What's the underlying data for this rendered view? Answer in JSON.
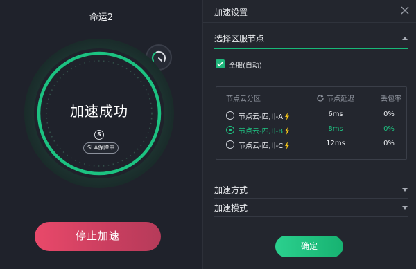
{
  "left": {
    "game_title": "命运2",
    "status": "加速成功",
    "shield_letter": "S",
    "sla_label": "SLA保障中",
    "stop_button": "停止加速"
  },
  "right": {
    "title": "加速设置",
    "region_section": "选择区服节点",
    "all_regions_label": "全服(自动)",
    "all_regions_checked": true,
    "table": {
      "headers": {
        "region": "节点云分区",
        "latency": "节点延迟",
        "loss": "丢包率"
      },
      "rows": [
        {
          "name": "节点云-四川-A",
          "latency": "6ms",
          "loss": "0%",
          "selected": false
        },
        {
          "name": "节点云-四川-B",
          "latency": "8ms",
          "loss": "0%",
          "selected": true
        },
        {
          "name": "节点云-四川-C",
          "latency": "12ms",
          "loss": "0%",
          "selected": false
        }
      ]
    },
    "method_section": "加速方式",
    "mode_section": "加速模式",
    "confirm_button": "确定"
  },
  "colors": {
    "accent_green": "#1fc382",
    "stop_red": "#e9496a",
    "background": "#1f222b",
    "bolt": "#f5c518"
  },
  "icons": {
    "gauge": "speedometer-icon",
    "close": "close-icon",
    "refresh": "refresh-icon",
    "bolt": "lightning-icon"
  }
}
